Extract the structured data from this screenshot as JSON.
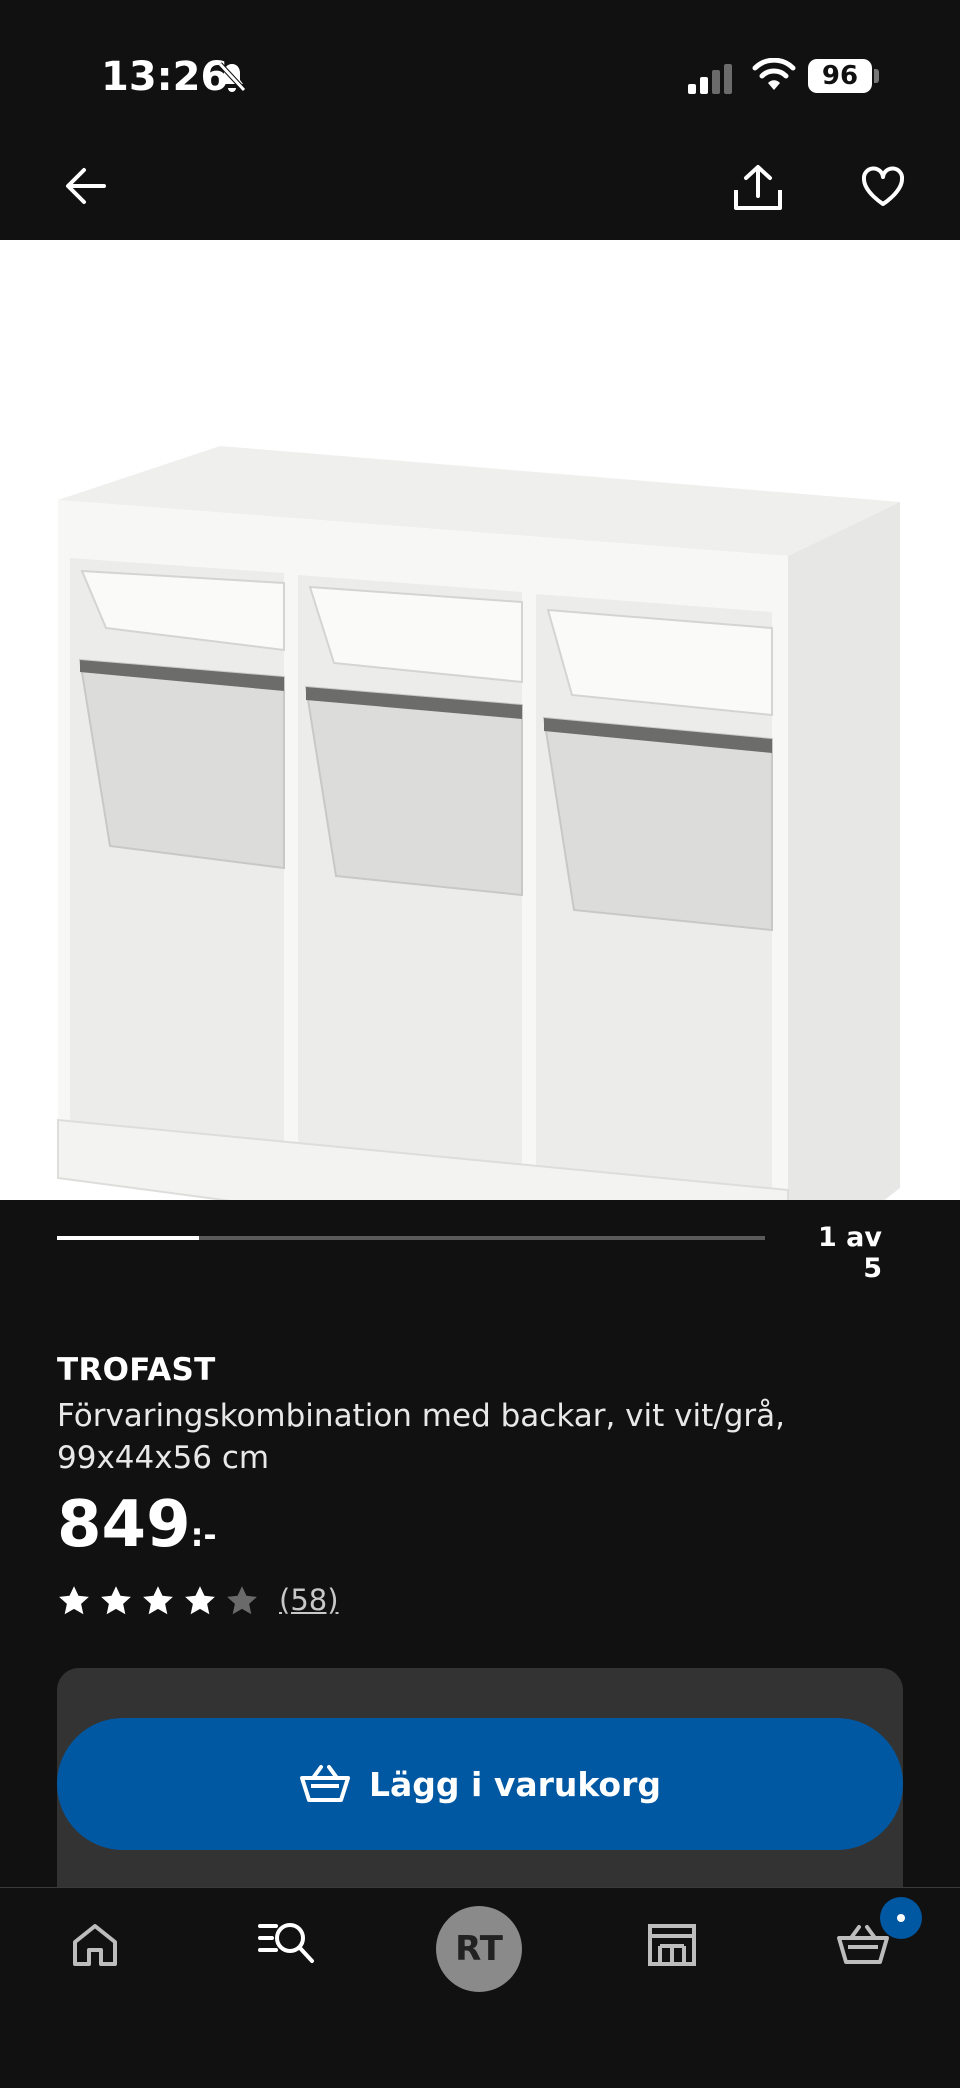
{
  "status_bar": {
    "time": "13:26",
    "battery": "96"
  },
  "gallery": {
    "counter": "1 av 5",
    "progress_fraction": 0.2
  },
  "product": {
    "brand": "TROFAST",
    "description": "Förvaringskombination med backar, vit vit/grå, 99x44x56 cm",
    "price": "849",
    "price_suffix": ":-",
    "rating": 4,
    "rating_max": 5,
    "review_count": "(58)"
  },
  "cart_button": {
    "label": "Lägg i varukorg"
  },
  "bottom_nav": {
    "avatar_initials": "RT"
  },
  "icons": [
    "back-arrow-icon",
    "share-icon",
    "heart-icon",
    "home-icon",
    "search-icon",
    "store-icon",
    "cart-icon",
    "bell-muted-icon",
    "cellular-signal-icon",
    "wifi-icon"
  ],
  "colors": {
    "accent": "#0058a3",
    "background": "#111111",
    "panel": "#333333"
  }
}
